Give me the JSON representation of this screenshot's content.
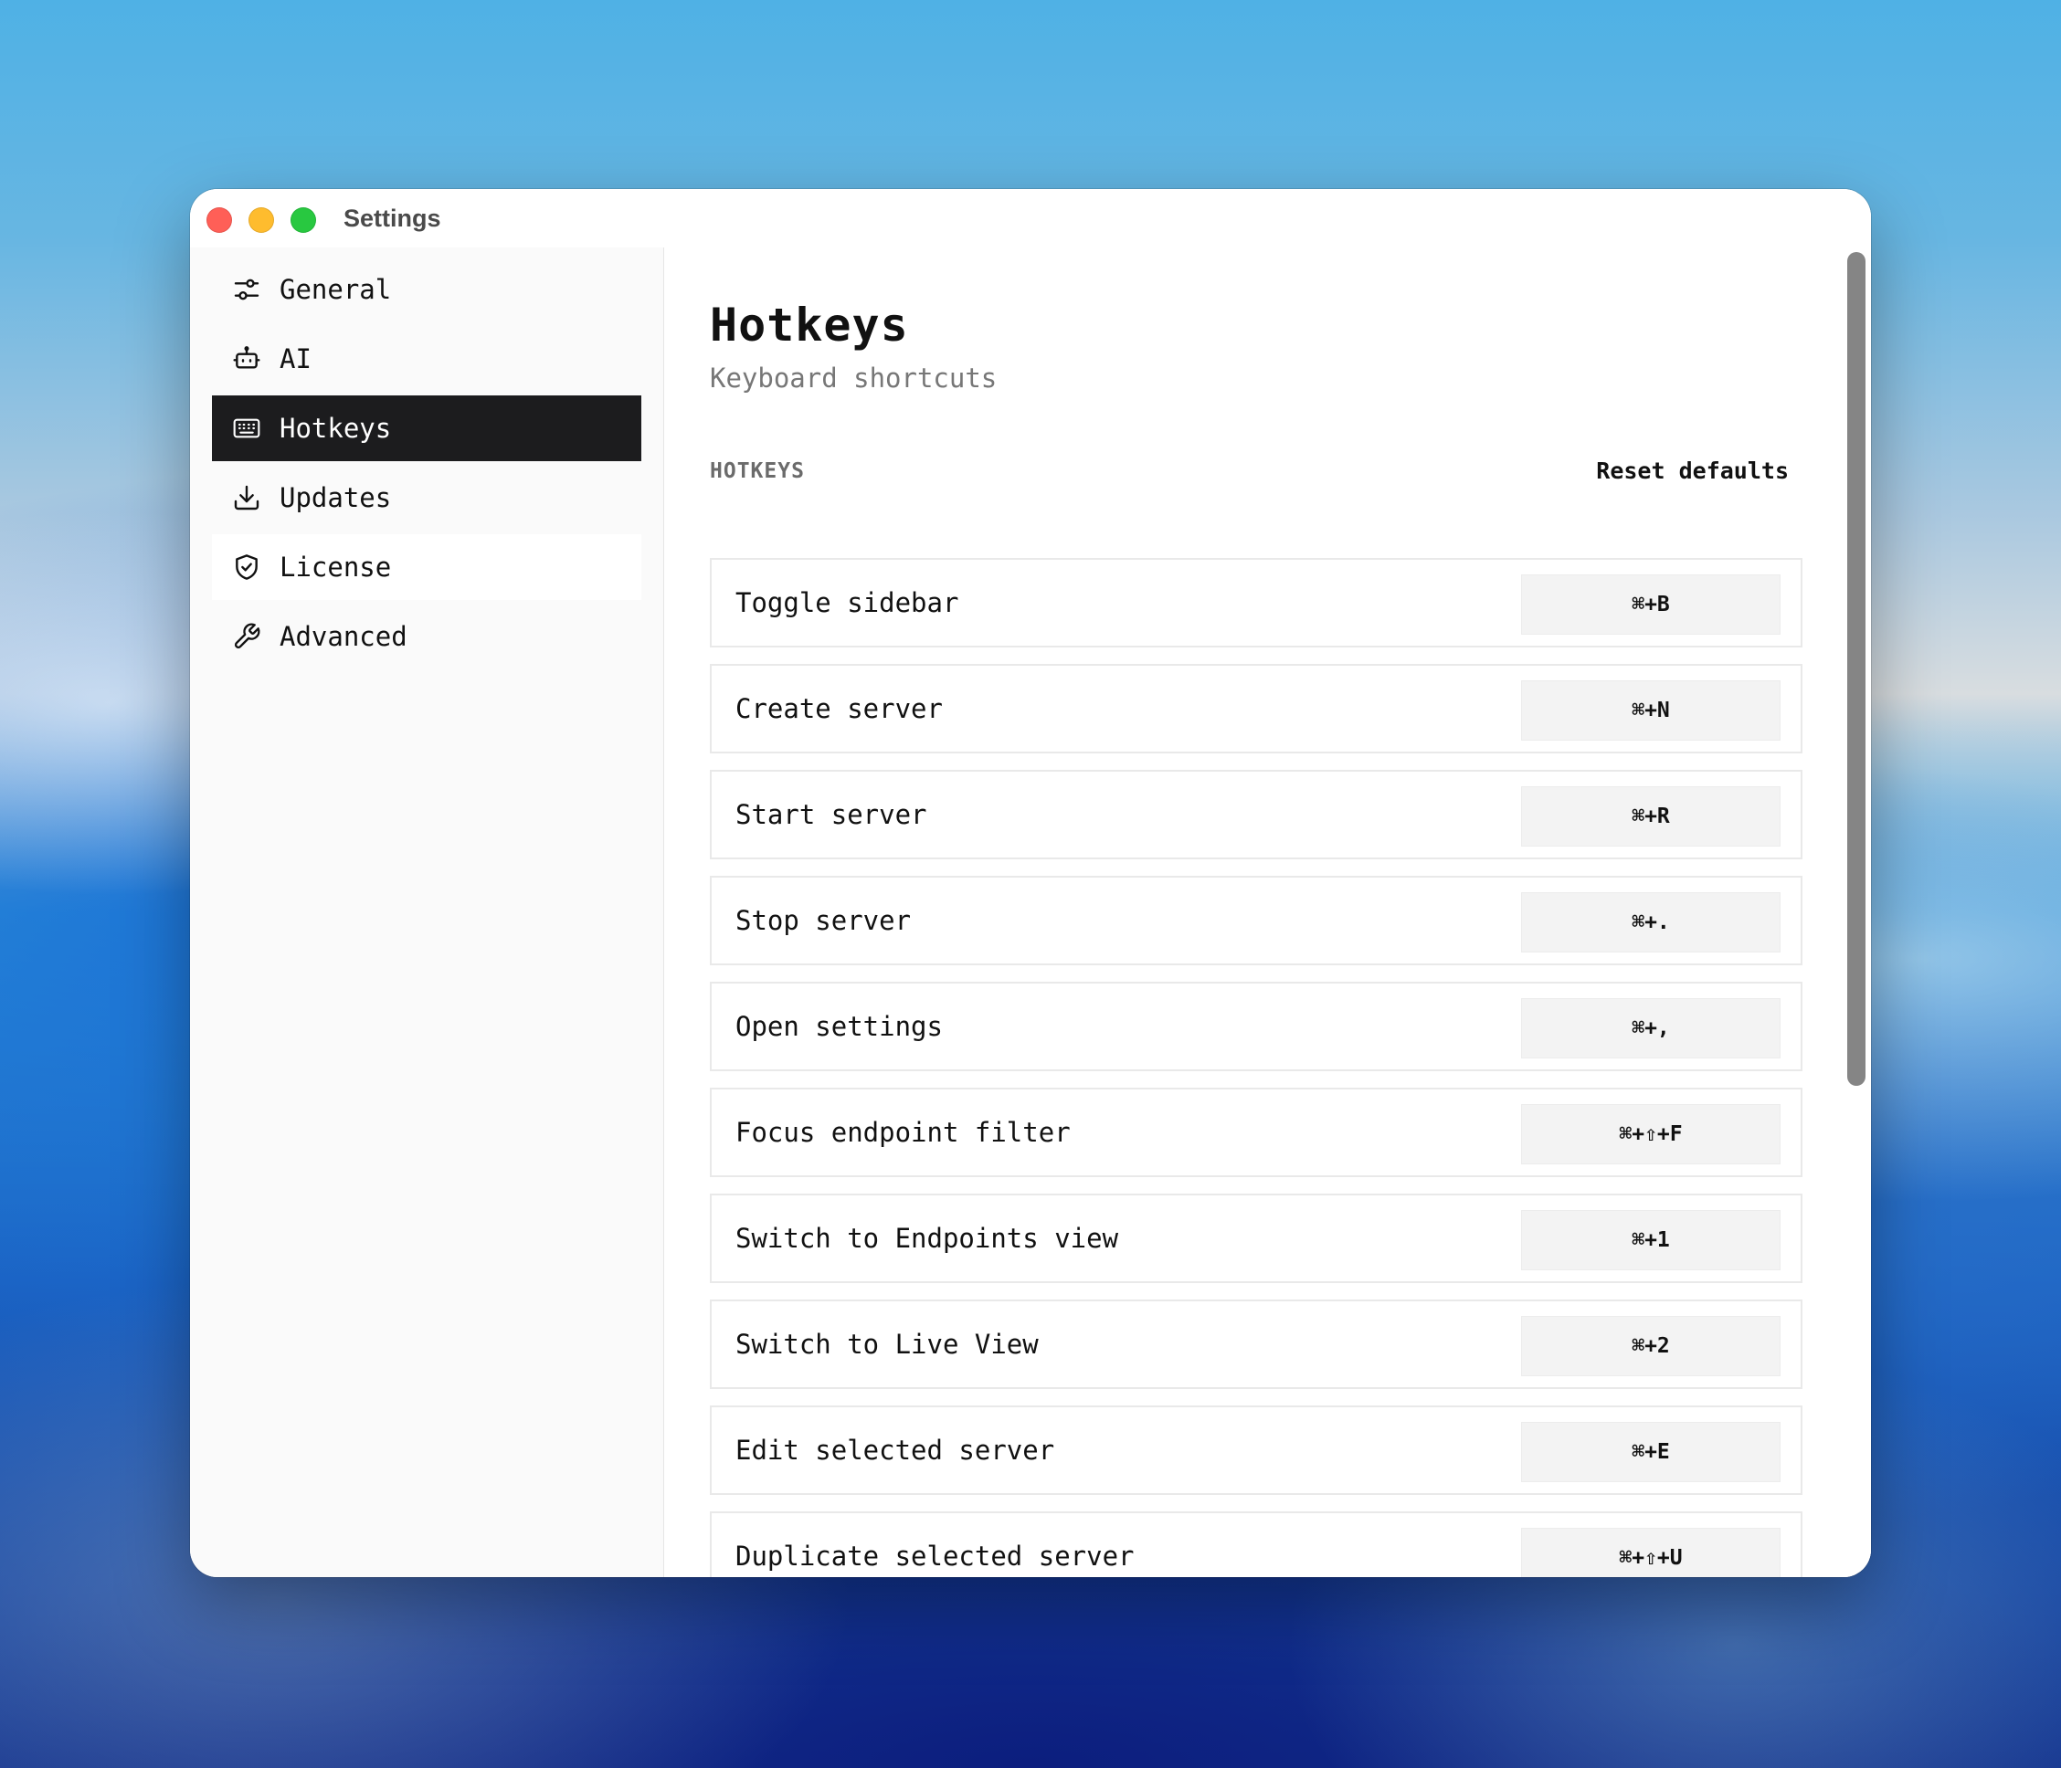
{
  "window": {
    "title": "Settings"
  },
  "sidebar": {
    "items": [
      {
        "label": "General",
        "icon": "sliders-icon",
        "active": false
      },
      {
        "label": "AI",
        "icon": "robot-icon",
        "active": false
      },
      {
        "label": "Hotkeys",
        "icon": "keyboard-icon",
        "active": true
      },
      {
        "label": "Updates",
        "icon": "download-icon",
        "active": false
      },
      {
        "label": "License",
        "icon": "shield-check-icon",
        "active": false,
        "hovered": true
      },
      {
        "label": "Advanced",
        "icon": "wrench-icon",
        "active": false
      }
    ]
  },
  "main": {
    "title": "Hotkeys",
    "subtitle": "Keyboard shortcuts",
    "section_label": "HOTKEYS",
    "reset_label": "Reset defaults",
    "hotkeys": [
      {
        "action": "Toggle sidebar",
        "shortcut": "⌘+B"
      },
      {
        "action": "Create server",
        "shortcut": "⌘+N"
      },
      {
        "action": "Start server",
        "shortcut": "⌘+R"
      },
      {
        "action": "Stop server",
        "shortcut": "⌘+."
      },
      {
        "action": "Open settings",
        "shortcut": "⌘+,"
      },
      {
        "action": "Focus endpoint filter",
        "shortcut": "⌘+⇧+F"
      },
      {
        "action": "Switch to Endpoints view",
        "shortcut": "⌘+1"
      },
      {
        "action": "Switch to Live View",
        "shortcut": "⌘+2"
      },
      {
        "action": "Edit selected server",
        "shortcut": "⌘+E"
      },
      {
        "action": "Duplicate selected server",
        "shortcut": "⌘+⇧+U"
      }
    ]
  },
  "colors": {
    "active_nav_bg": "#1c1c1e",
    "traffic_red": "#ff5f57",
    "traffic_yellow": "#febc2e",
    "traffic_green": "#28c840"
  }
}
